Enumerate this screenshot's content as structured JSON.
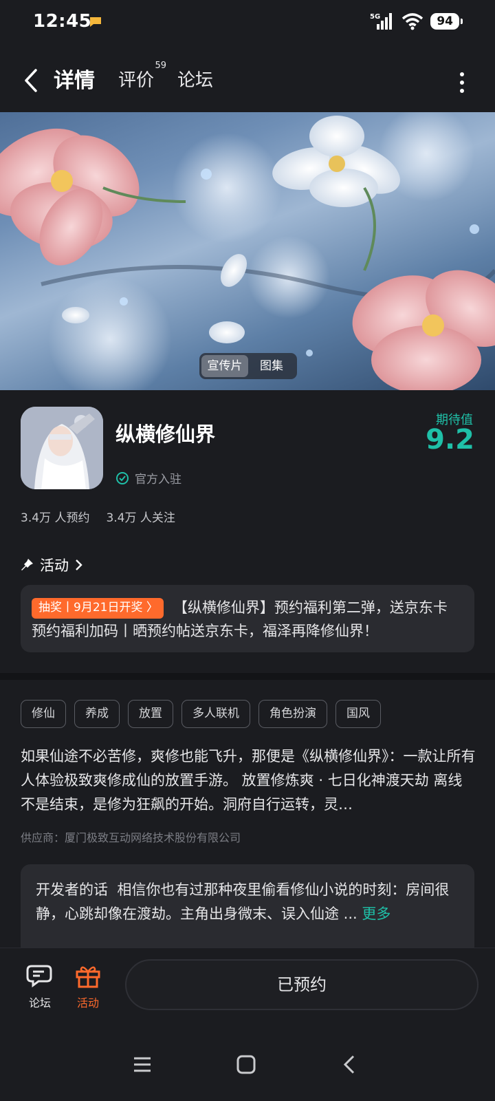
{
  "status_bar": {
    "time": "12:45",
    "network": "5G",
    "battery": "94"
  },
  "nav": {
    "tabs": [
      "详情",
      "评价",
      "论坛"
    ],
    "review_count": "59"
  },
  "banner": {
    "media_tabs": [
      "宣传片",
      "图集"
    ]
  },
  "game": {
    "title": "纵横修仙界",
    "official_label": "官方入驻",
    "expect_label": "期待值",
    "expect_value": "9.2",
    "reservations": "3.4万 人预约",
    "followers": "3.4万 人关注"
  },
  "activity": {
    "heading": "活动",
    "badge": "抽奖丨9月21日开奖 〉",
    "text": "【纵横修仙界】预约福利第二弹，送京东卡 预约福利加码丨晒预约帖送京东卡，福泽再降修仙界！"
  },
  "tags": [
    "修仙",
    "养成",
    "放置",
    "多人联机",
    "角色扮演",
    "国风"
  ],
  "description": "如果仙途不必苦修，爽修也能飞升，那便是《纵横修仙界》：一款让所有人体验极致爽修成仙的放置手游。 放置修炼爽 · 七日化神渡天劫 离线不是结束，是修为狂飙的开始。洞府自行运转，灵…",
  "supplier": "供应商：厦门极致互动网络技术股份有限公司",
  "developer_note": {
    "label": "开发者的话",
    "text": "相信你也有过那种夜里偷看修仙小说的时刻：房间很静，心跳却像在渡劫。主角出身微末、误入仙途 ...",
    "more": "更多"
  },
  "bottom_bar": {
    "forum_label": "论坛",
    "activity_label": "活动",
    "reserve_label": "已预约"
  },
  "colors": {
    "accent": "#1fc0a8",
    "orange": "#ff6a2c",
    "background": "#1b1c20"
  }
}
